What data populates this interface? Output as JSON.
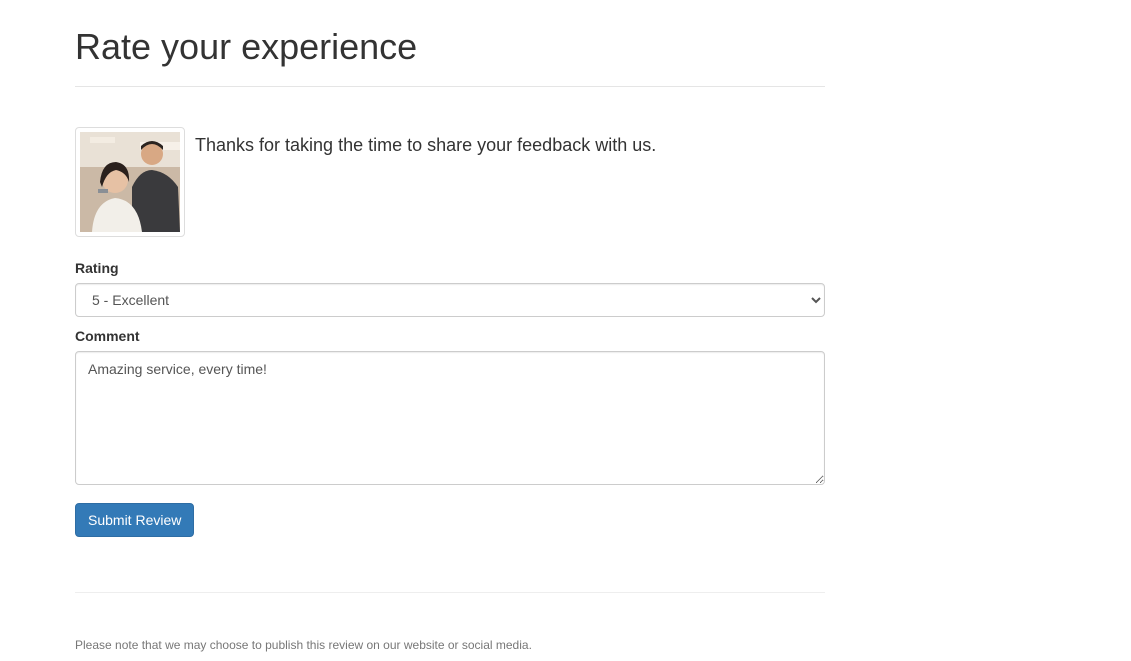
{
  "page": {
    "title": "Rate your experience",
    "intro": "Thanks for taking the time to share your feedback with us.",
    "photo_icon": "salon-photo"
  },
  "form": {
    "rating_label": "Rating",
    "rating_selected": "5 - Excellent",
    "comment_label": "Comment",
    "comment_value": "Amazing service, every time!",
    "submit_label": "Submit Review"
  },
  "footer": {
    "note": "Please note that we may choose to publish this review on our website or social media."
  },
  "colors": {
    "primary": "#337ab7",
    "text": "#333333",
    "muted": "#777777"
  }
}
